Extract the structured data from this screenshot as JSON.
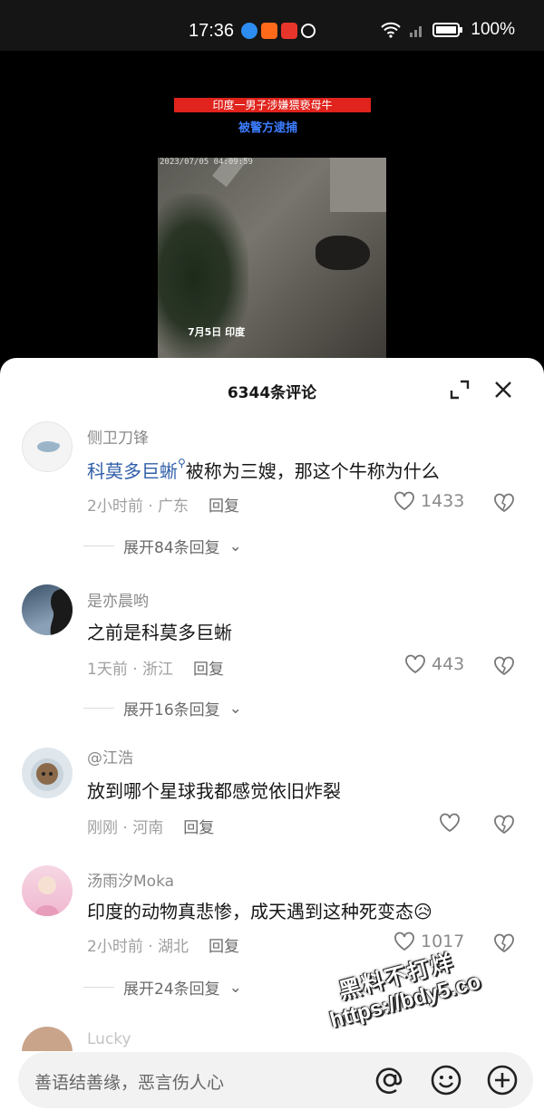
{
  "status_bar": {
    "time": "17:36",
    "battery": "100%"
  },
  "video": {
    "title_text": "印度一男子涉嫌猥亵母牛",
    "subtitle": "被警方逮捕",
    "timestamp": "2023/07/05 04:09:59",
    "caption": "7月5日 印度"
  },
  "sheet": {
    "title": "6344条评论",
    "expand_icon": "expand-icon",
    "close_icon": "close-icon"
  },
  "comments": [
    {
      "user": "侧卫刀锋",
      "mention": "科莫多巨蜥",
      "text": "被称为三嫂，那这个牛称为什么",
      "time": "2小时前",
      "location": "广东",
      "reply": "回复",
      "likes": "1433",
      "expand": "展开84条回复"
    },
    {
      "user": "是亦晨哟",
      "text": "之前是科莫多巨蜥",
      "time": "1天前",
      "location": "浙江",
      "reply": "回复",
      "likes": "443",
      "expand": "展开16条回复"
    },
    {
      "user": "@江浩",
      "text": "放到哪个星球我都感觉依旧炸裂",
      "time": "刚刚",
      "location": "河南",
      "reply": "回复",
      "likes": ""
    },
    {
      "user": "汤雨汐Moka",
      "text": "印度的动物真悲惨，成天遇到这种死变态😥",
      "time": "2小时前",
      "location": "湖北",
      "reply": "回复",
      "likes": "1017",
      "expand": "展开24条回复"
    },
    {
      "user": "Lucky"
    }
  ],
  "input": {
    "placeholder": "善语结善缘，恶言伤人心"
  },
  "watermark": {
    "line1": "黑料不打烊",
    "line2": "https://bdy5.co"
  }
}
